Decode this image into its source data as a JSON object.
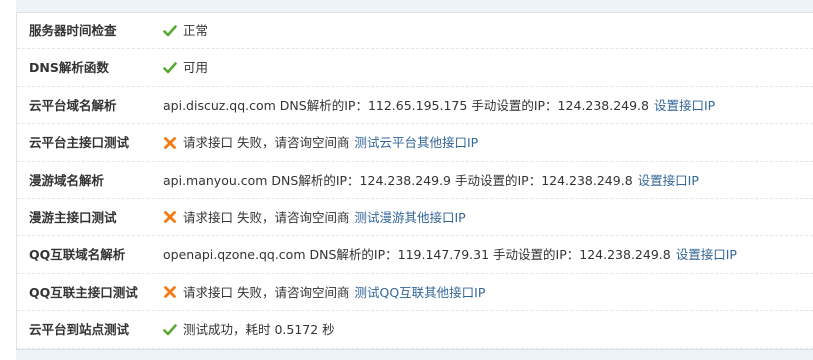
{
  "rows": [
    {
      "label": "服务器时间检查",
      "status": "ok",
      "text": "正常",
      "link": ""
    },
    {
      "label": "DNS解析函数",
      "status": "ok",
      "text": "可用",
      "link": ""
    },
    {
      "label": "云平台域名解析",
      "status": "none",
      "text": "api.discuz.qq.com DNS解析的IP：112.65.195.175 手动设置的IP：124.238.249.8",
      "link": "设置接口IP"
    },
    {
      "label": "云平台主接口测试",
      "status": "fail",
      "text": "请求接口 失败，请咨询空间商",
      "link": "测试云平台其他接口IP"
    },
    {
      "label": "漫游域名解析",
      "status": "none",
      "text": "api.manyou.com DNS解析的IP：124.238.249.9 手动设置的IP：124.238.249.8",
      "link": "设置接口IP"
    },
    {
      "label": "漫游主接口测试",
      "status": "fail",
      "text": "请求接口 失败，请咨询空间商",
      "link": "测试漫游其他接口IP"
    },
    {
      "label": "QQ互联域名解析",
      "status": "none",
      "text": "openapi.qzone.qq.com DNS解析的IP：119.147.79.31 手动设置的IP：124.238.249.8",
      "link": "设置接口IP"
    },
    {
      "label": "QQ互联主接口测试",
      "status": "fail",
      "text": "请求接口 失败，请咨询空间商",
      "link": "测试QQ互联其他接口IP"
    },
    {
      "label": "云平台到站点测试",
      "status": "ok",
      "text": "测试成功，耗时 0.5172 秒",
      "link": ""
    }
  ],
  "icons": {
    "ok": "check-icon",
    "fail": "cross-icon"
  },
  "colors": {
    "ok": "#5aa832",
    "fail": "#f07c12",
    "link": "#336699"
  }
}
